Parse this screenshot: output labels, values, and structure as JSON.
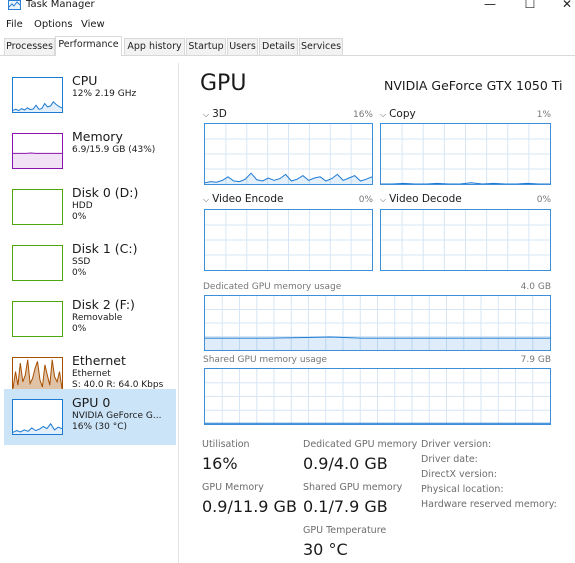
{
  "window": {
    "title": "Task Manager",
    "minimize": "—",
    "maximize": "☐",
    "close": "✕"
  },
  "menu": [
    "File",
    "Options",
    "View"
  ],
  "tabs": [
    {
      "label": "Processes",
      "active": false
    },
    {
      "label": "Performance",
      "active": true
    },
    {
      "label": "App history",
      "active": false
    },
    {
      "label": "Startup",
      "active": false
    },
    {
      "label": "Users",
      "active": false
    },
    {
      "label": "Details",
      "active": false
    },
    {
      "label": "Services",
      "active": false
    }
  ],
  "sidebar": [
    {
      "id": "cpu",
      "title": "CPU",
      "lines": [
        "12%  2.19 GHz"
      ]
    },
    {
      "id": "memory",
      "title": "Memory",
      "lines": [
        "6.9/15.9 GB (43%)"
      ]
    },
    {
      "id": "disk0",
      "title": "Disk 0 (D:)",
      "lines": [
        "HDD",
        "0%"
      ]
    },
    {
      "id": "disk1",
      "title": "Disk 1 (C:)",
      "lines": [
        "SSD",
        "0%"
      ]
    },
    {
      "id": "disk2",
      "title": "Disk 2 (F:)",
      "lines": [
        "Removable",
        "0%"
      ]
    },
    {
      "id": "ethernet",
      "title": "Ethernet",
      "lines": [
        "Ethernet",
        "S: 40.0  R: 64.0 Kbps"
      ]
    },
    {
      "id": "gpu0",
      "title": "GPU 0",
      "lines": [
        "NVIDIA GeForce G...",
        "16%  (30 °C)"
      ],
      "selected": true
    }
  ],
  "main": {
    "heading": "GPU",
    "model": "NVIDIA GeForce GTX 1050 Ti",
    "graphs": {
      "g3d": {
        "label": "3D",
        "percent": "16%"
      },
      "copy": {
        "label": "Copy",
        "percent": "1%"
      },
      "video_encode": {
        "label": "Video Encode",
        "percent": "0%"
      },
      "video_decode": {
        "label": "Video Decode",
        "percent": "0%"
      }
    },
    "dedicated_memory_graph": {
      "label": "Dedicated GPU memory usage",
      "max": "4.0 GB"
    },
    "shared_memory_graph": {
      "label": "Shared GPU memory usage",
      "max": "7.9 GB"
    },
    "stats": {
      "utilisation": {
        "label": "Utilisation",
        "value": "16%"
      },
      "dedicated": {
        "label": "Dedicated GPU memory",
        "value": "0.9/4.0 GB"
      },
      "gpu_memory": {
        "label": "GPU Memory",
        "value": "0.9/11.9 GB"
      },
      "shared": {
        "label": "Shared GPU memory",
        "value": "0.1/7.9 GB"
      },
      "temperature": {
        "label": "GPU Temperature",
        "value": "30 °C"
      }
    },
    "info": [
      "Driver version:",
      "Driver date:",
      "DirectX version:",
      "Physical location:",
      "Hardware reserved memory:"
    ]
  },
  "colors": {
    "cpu_line": "#1c7ad3",
    "memory_line": "#8b12ae",
    "disk_line": "#4da60c",
    "ethernet_line": "#a74f01",
    "gpu_line": "#1c7ad3",
    "grid": "#d6e6f5",
    "selected_bg": "#cce4f7"
  },
  "series": {
    "cpu": [
      0.05,
      0.08,
      0.04,
      0.1,
      0.06,
      0.12,
      0.07,
      0.09,
      0.2,
      0.08,
      0.1,
      0.25,
      0.15,
      0.18,
      0.3,
      0.22,
      0.16,
      0.12
    ],
    "memory": [
      0.43,
      0.43,
      0.43,
      0.43,
      0.44,
      0.43,
      0.43,
      0.43,
      0.43,
      0.43,
      0.43,
      0.43
    ],
    "ethernet": [
      0.1,
      0.6,
      0.2,
      0.85,
      0.3,
      0.5,
      0.95,
      0.25,
      0.4,
      0.7,
      0.9,
      0.35,
      0.15,
      0.8,
      0.5,
      0.2,
      0.95,
      0.45,
      0.3,
      0.6,
      0.1
    ],
    "gpu_thumb": [
      0.05,
      0.1,
      0.06,
      0.12,
      0.08,
      0.18,
      0.1,
      0.14,
      0.22,
      0.16,
      0.3,
      0.12,
      0.2,
      0.16
    ],
    "gpu_3d": [
      0.02,
      0.04,
      0.03,
      0.06,
      0.12,
      0.05,
      0.04,
      0.08,
      0.18,
      0.07,
      0.05,
      0.1,
      0.06,
      0.09,
      0.16,
      0.05,
      0.08,
      0.14,
      0.06,
      0.1,
      0.12,
      0.05,
      0.09,
      0.16,
      0.06,
      0.1,
      0.14,
      0.05,
      0.08,
      0.12
    ],
    "gpu_copy": [
      0,
      0,
      0.01,
      0,
      0,
      0.01,
      0,
      0,
      0.02,
      0,
      0.01,
      0,
      0,
      0.01,
      0,
      0
    ],
    "dedicated_usage": [
      0.22,
      0.22,
      0.22,
      0.23,
      0.24,
      0.22,
      0.22,
      0.22,
      0.22,
      0.22,
      0.22,
      0.22
    ],
    "shared_usage": [
      0.0125,
      0.0125,
      0.0125,
      0.0125,
      0.0125,
      0.0125
    ]
  }
}
